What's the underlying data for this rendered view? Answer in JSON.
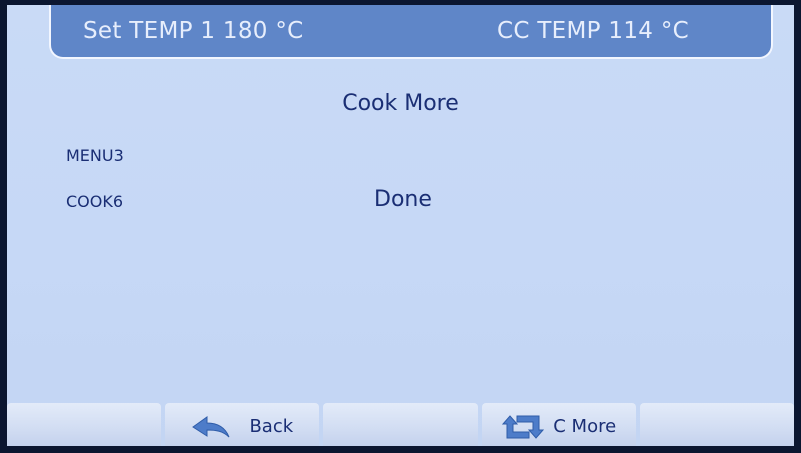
{
  "header": {
    "set_temp": "Set TEMP 1 180 °C",
    "cc_temp": "CC TEMP 114 °C"
  },
  "main": {
    "title": "Cook More",
    "menu_label": "MENU3",
    "cook_label": "COOK6",
    "status": "Done"
  },
  "bottom_bar": {
    "back_label": "Back",
    "cmore_label": "C More",
    "back_icon": "back-arrow-icon",
    "cmore_icon": "repeat-icon"
  },
  "colors": {
    "screen_bg": "#c6d8f6",
    "header_bg": "#5f86c8",
    "text": "#1a2e74",
    "icon": "#4d7cc9"
  }
}
